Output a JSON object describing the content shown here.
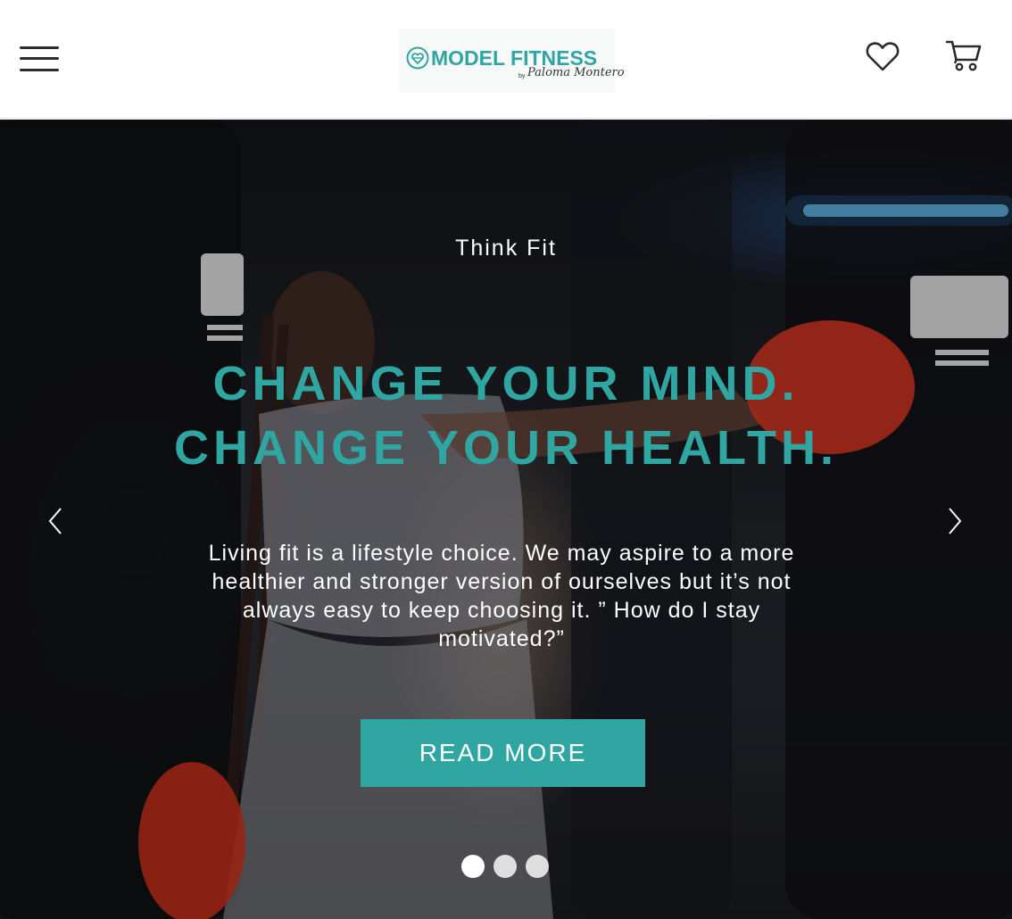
{
  "header": {
    "logo": {
      "brand": "MODEL FITNESS",
      "by": "by",
      "signature": "Paloma Montero"
    },
    "icons": {
      "menu": "hamburger-menu-icon",
      "wishlist": "heart-icon",
      "cart": "shopping-cart-icon"
    }
  },
  "hero": {
    "eyebrow": "Think Fit",
    "headline_line1": "CHANGE YOUR MIND.",
    "headline_line2": "CHANGE YOUR HEALTH.",
    "body": "Living fit is a lifestyle choice. We may aspire to a more healthier and stronger version of ourselves but it’s not always easy to keep choosing it. ” How do I stay motivated?”",
    "cta_label": "READ MORE",
    "carousel": {
      "slide_count": 3,
      "active_slide": 1,
      "prev_icon": "chevron-left-icon",
      "next_icon": "chevron-right-icon"
    }
  },
  "colors": {
    "accent": "#2fa6a2",
    "header_bg": "#ffffff",
    "text_light": "#ffffff",
    "icon_dark": "#2b2b2b"
  }
}
